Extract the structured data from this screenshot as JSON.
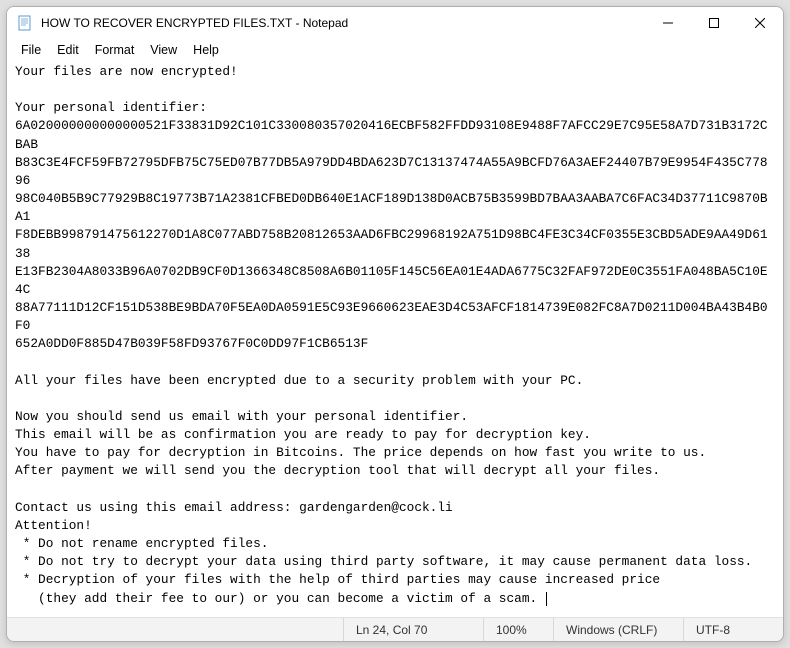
{
  "window": {
    "title": "HOW TO RECOVER ENCRYPTED FILES.TXT - Notepad"
  },
  "menu": {
    "file": "File",
    "edit": "Edit",
    "format": "Format",
    "view": "View",
    "help": "Help"
  },
  "document": {
    "line1": "Your files are now encrypted!",
    "blank1": "",
    "line2": "Your personal identifier:",
    "id1": "6A020000000000000521F33831D92C101C330080357020416ECBF582FFDD93108E9488F7AFCC29E7C95E58A7D731B3172CBAB",
    "id2": "B83C3E4FCF59FB72795DFB75C75ED07B77DB5A979DD4BDA623D7C13137474A55A9BCFD76A3AEF24407B79E9954F435C77896",
    "id3": "98C040B5B9C77929B8C19773B71A2381CFBED0DB640E1ACF189D138D0ACB75B3599BD7BAA3AABA7C6FAC34D37711C9870BA1",
    "id4": "F8DEBB998791475612270D1A8C077ABD758B20812653AAD6FBC29968192A751D98BC4FE3C34CF0355E3CBD5ADE9AA49D6138",
    "id5": "E13FB2304A8033B96A0702DB9CF0D1366348C8508A6B01105F145C56EA01E4ADA6775C32FAF972DE0C3551FA048BA5C10E4C",
    "id6": "88A77111D12CF151D538BE9BDA70F5EA0DA0591E5C93E9660623EAE3D4C53AFCF1814739E082FC8A7D0211D004BA43B4B0F0",
    "id7": "652A0DD0F885D47B039F58FD93767F0C0DD97F1CB6513F",
    "blank2": "",
    "line3": "All your files have been encrypted due to a security problem with your PC.",
    "blank3": "",
    "line4": "Now you should send us email with your personal identifier.",
    "line5": "This email will be as confirmation you are ready to pay for decryption key.",
    "line6": "You have to pay for decryption in Bitcoins. The price depends on how fast you write to us.",
    "line7": "After payment we will send you the decryption tool that will decrypt all your files.",
    "blank4": "",
    "line8": "Contact us using this email address: gardengarden@cock.li",
    "line9": "Attention!",
    "line10": " * Do not rename encrypted files.",
    "line11": " * Do not try to decrypt your data using third party software, it may cause permanent data loss.",
    "line12": " * Decryption of your files with the help of third parties may cause increased price",
    "line13": "   (they add their fee to our) or you can become a victim of a scam. "
  },
  "status": {
    "position": "Ln 24, Col 70",
    "zoom": "100%",
    "eol": "Windows (CRLF)",
    "encoding": "UTF-8"
  }
}
